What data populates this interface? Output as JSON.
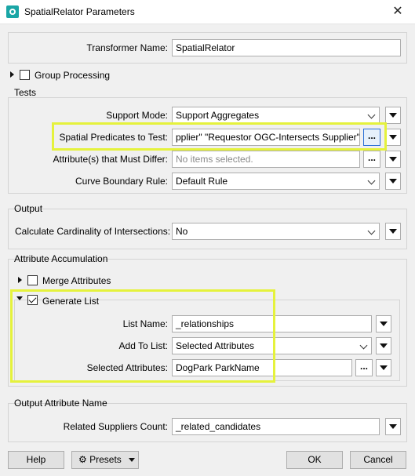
{
  "window": {
    "title": "SpatialRelator Parameters",
    "close_glyph": "✕"
  },
  "transformer": {
    "label": "Transformer Name:",
    "value": "SpatialRelator"
  },
  "group_processing": {
    "label": "Group Processing",
    "checked": false
  },
  "tests": {
    "legend": "Tests",
    "support_mode": {
      "label": "Support Mode:",
      "value": "Support Aggregates"
    },
    "predicates": {
      "label": "Spatial Predicates to Test:",
      "value": "pplier\" \"Requestor OGC-Intersects Supplier\""
    },
    "must_differ": {
      "label": "Attribute(s) that Must Differ:",
      "placeholder": "No items selected."
    },
    "curve_rule": {
      "label": "Curve Boundary Rule:",
      "value": "Default Rule"
    }
  },
  "output": {
    "legend": "Output",
    "cardinality": {
      "label": "Calculate Cardinality of Intersections:",
      "value": "No"
    }
  },
  "accumulation": {
    "legend": "Attribute Accumulation",
    "merge": {
      "label": "Merge Attributes",
      "checked": false
    },
    "generate": {
      "label": "Generate List",
      "checked": true
    },
    "list_name": {
      "label": "List Name:",
      "value": "_relationships"
    },
    "add_to_list": {
      "label": "Add To List:",
      "value": "Selected Attributes"
    },
    "selected": {
      "label": "Selected Attributes:",
      "value": "DogPark ParkName"
    }
  },
  "output_attr": {
    "legend": "Output Attribute Name",
    "related_count": {
      "label": "Related Suppliers Count:",
      "value": "_related_candidates"
    }
  },
  "buttons": {
    "help": "Help",
    "presets": "Presets",
    "ok": "OK",
    "cancel": "Cancel"
  },
  "glyphs": {
    "ellipsis": "..."
  },
  "colors": {
    "highlight": "#e5f23c",
    "active_border": "#2a6fd6"
  }
}
